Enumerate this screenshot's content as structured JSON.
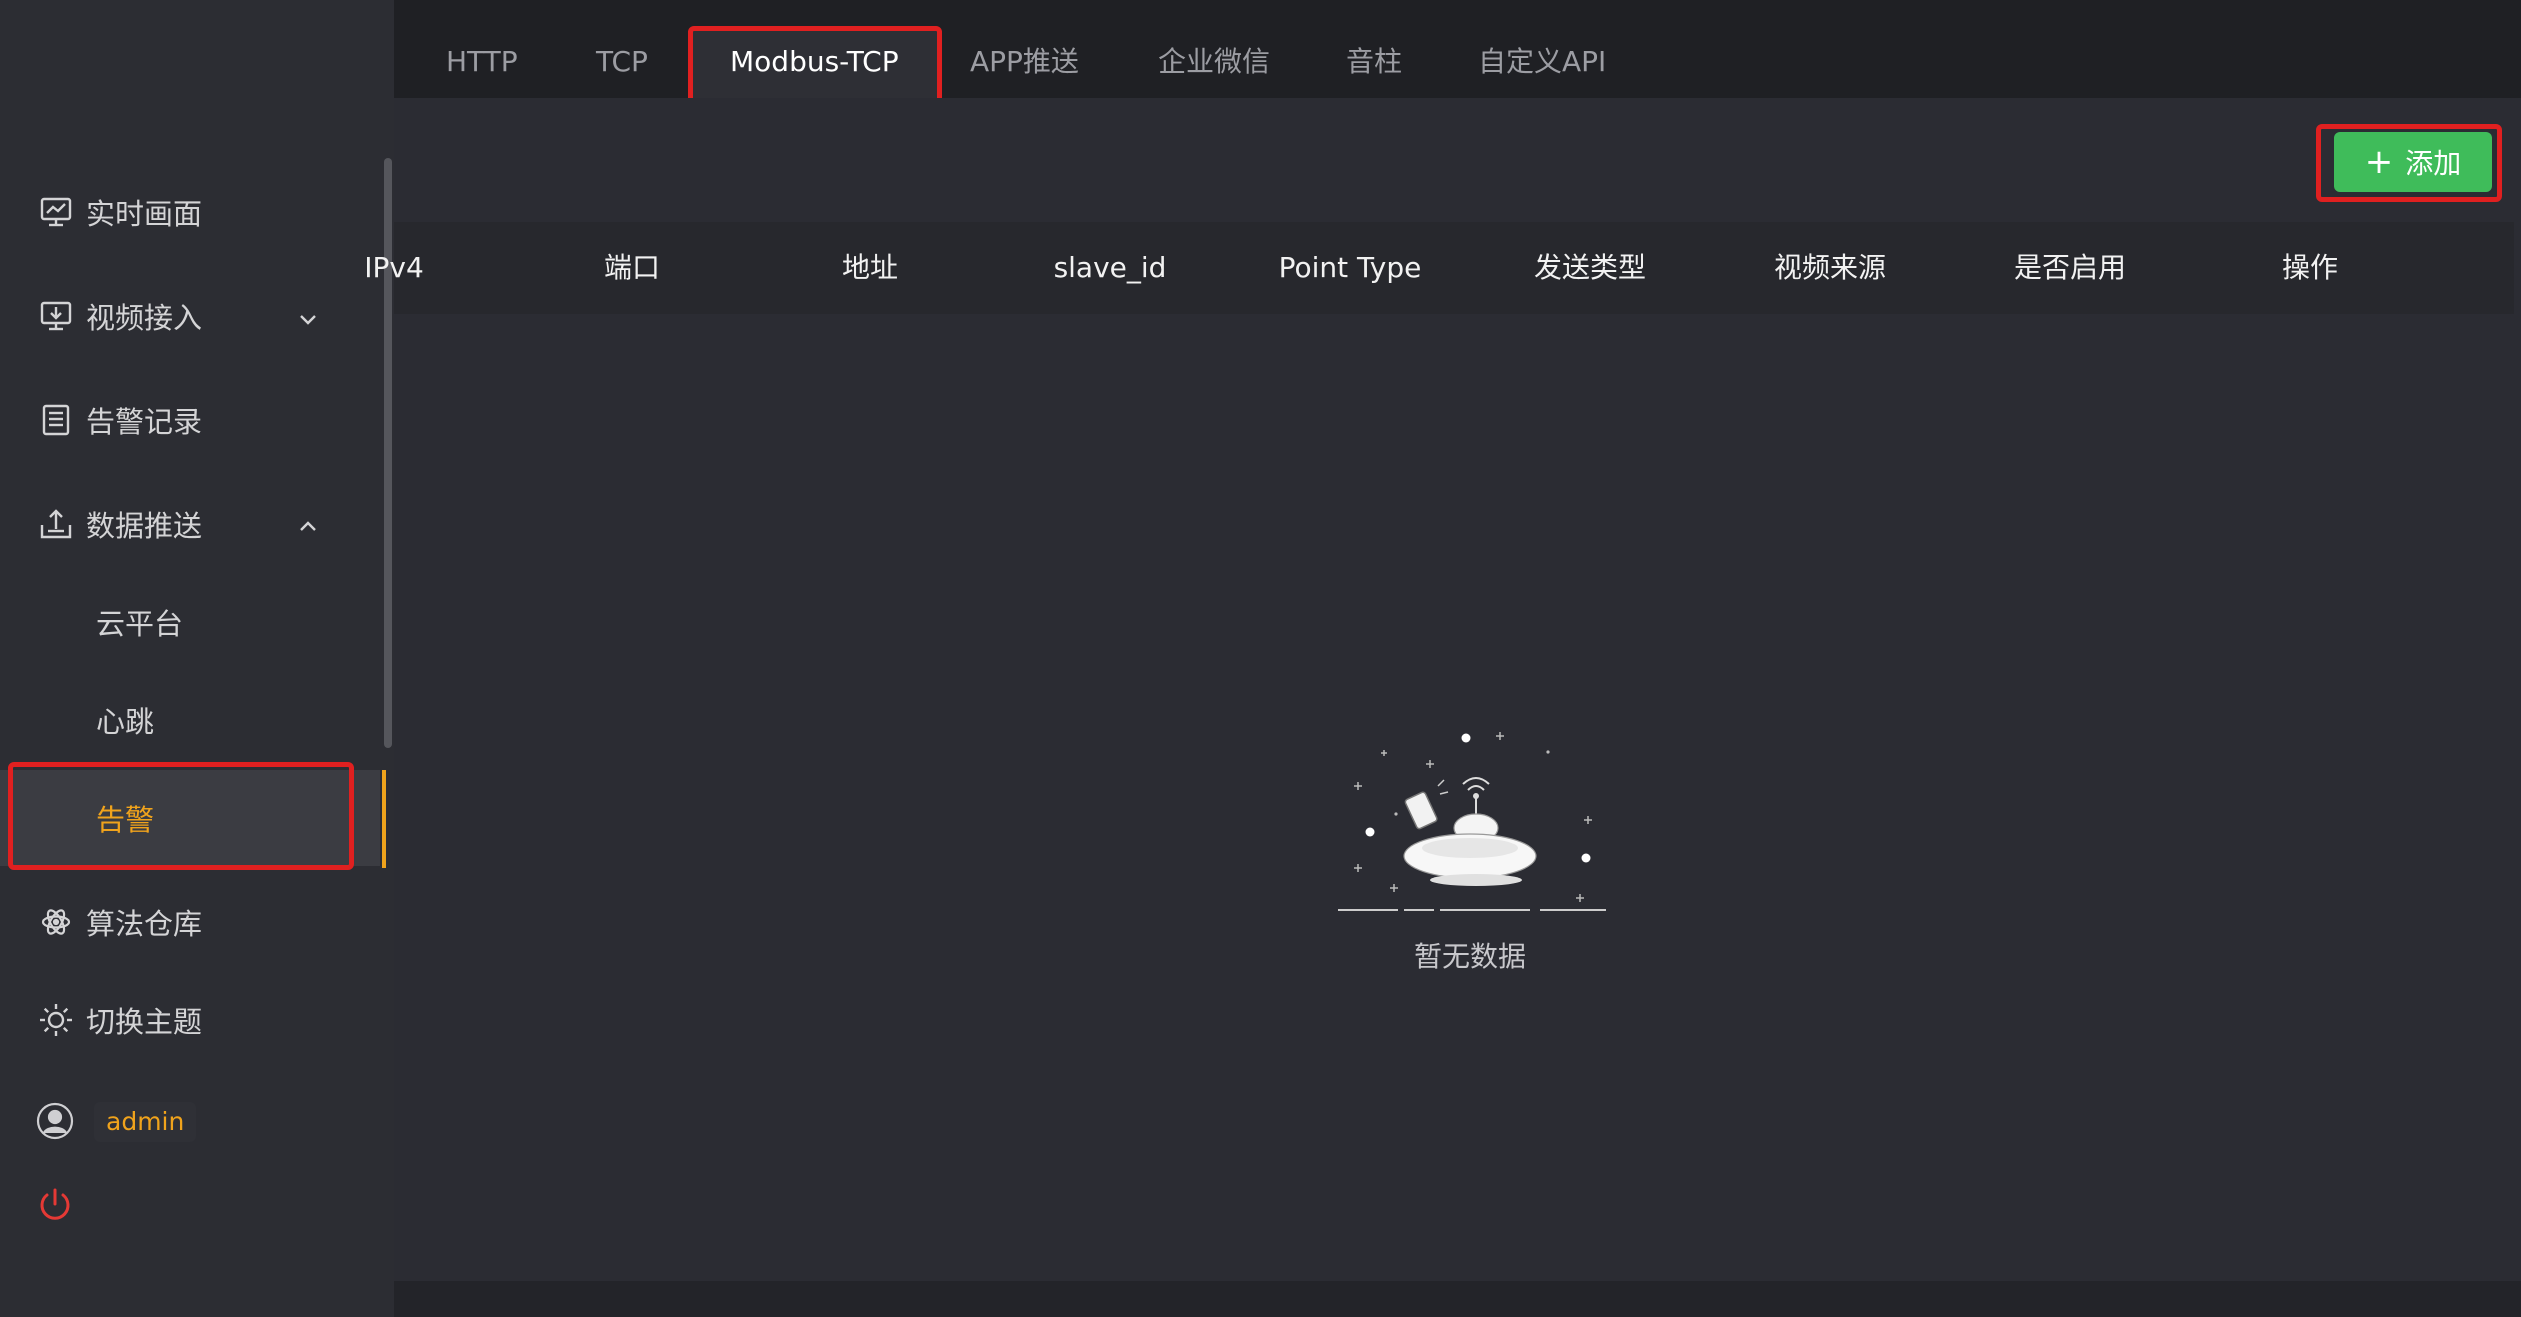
{
  "sidebar": {
    "items": [
      {
        "label": "实时画面",
        "icon": "monitor-chart-icon"
      },
      {
        "label": "视频接入",
        "icon": "video-input-icon",
        "chevron": "down"
      },
      {
        "label": "告警记录",
        "icon": "list-document-icon"
      },
      {
        "label": "数据推送",
        "icon": "upload-tray-icon",
        "chevron": "up"
      },
      {
        "label": "算法仓库",
        "icon": "atom-icon"
      },
      {
        "label": "切换主题",
        "icon": "sun-icon"
      }
    ],
    "sub_items": [
      {
        "label": "云平台"
      },
      {
        "label": "心跳"
      },
      {
        "label": "告警",
        "active": true
      }
    ],
    "user": {
      "name": "admin"
    }
  },
  "tabs": [
    {
      "label": "HTTP"
    },
    {
      "label": "TCP"
    },
    {
      "label": "Modbus-TCP",
      "active": true
    },
    {
      "label": "APP推送"
    },
    {
      "label": "企业微信"
    },
    {
      "label": "音柱"
    },
    {
      "label": "自定义API"
    }
  ],
  "toolbar": {
    "add_label": "添加"
  },
  "table": {
    "columns": [
      "IPv4",
      "端口",
      "地址",
      "slave_id",
      "Point Type",
      "发送类型",
      "视频来源",
      "是否启用",
      "操作"
    ],
    "rows": [],
    "empty_text": "暂无数据"
  },
  "colors": {
    "accent": "#f0a31c",
    "add_button": "#3fbc5a",
    "highlight": "#e02020",
    "power": "#e53935"
  }
}
